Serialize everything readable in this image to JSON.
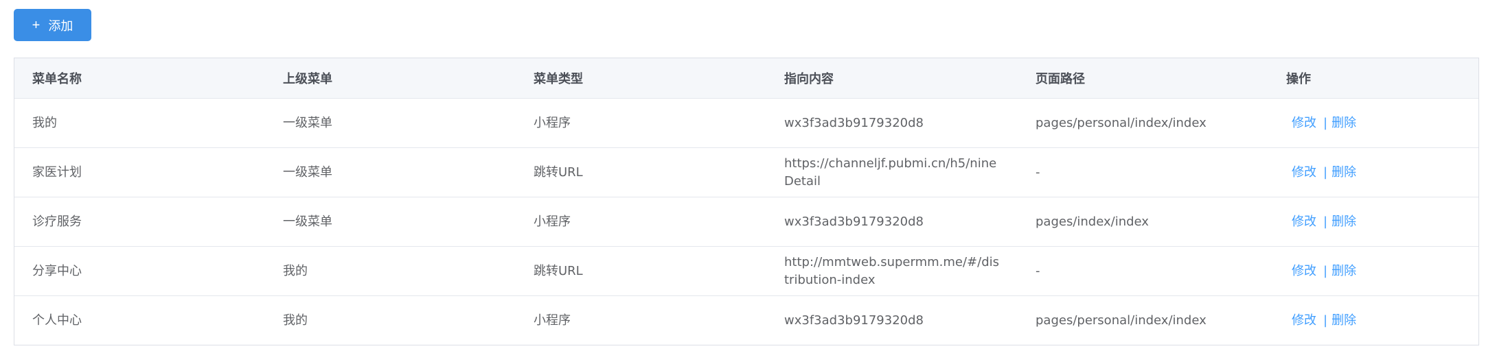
{
  "toolbar": {
    "add_icon": "plus-icon",
    "add_label": "添加"
  },
  "table": {
    "columns": [
      "菜单名称",
      "上级菜单",
      "菜单类型",
      "指向内容",
      "页面路径",
      "操作"
    ],
    "rows": [
      {
        "name": "我的",
        "parent": "一级菜单",
        "type": "小程序",
        "target": "wx3f3ad3b9179320d8",
        "path": "pages/personal/index/index",
        "edit": "修改",
        "delete": "删除"
      },
      {
        "name": "家医计划",
        "parent": "一级菜单",
        "type": "跳转URL",
        "target": "https://channeljf.pubmi.cn/h5/nineDetail",
        "path": "-",
        "edit": "修改",
        "delete": "删除"
      },
      {
        "name": "诊疗服务",
        "parent": "一级菜单",
        "type": "小程序",
        "target": "wx3f3ad3b9179320d8",
        "path": "pages/index/index",
        "edit": "修改",
        "delete": "删除"
      },
      {
        "name": "分享中心",
        "parent": "我的",
        "type": "跳转URL",
        "target": "http://mmtweb.supermm.me/#/distribution-index",
        "path": "-",
        "edit": "修改",
        "delete": "删除"
      },
      {
        "name": "个人中心",
        "parent": "我的",
        "type": "小程序",
        "target": "wx3f3ad3b9179320d8",
        "path": "pages/personal/index/index",
        "edit": "修改",
        "delete": "删除"
      }
    ],
    "separator": "|"
  },
  "colors": {
    "primary": "#409eff",
    "button_bg": "#3a8ee6",
    "header_bg": "#f5f7fa",
    "border": "#e4e7ed",
    "text": "#606266"
  }
}
